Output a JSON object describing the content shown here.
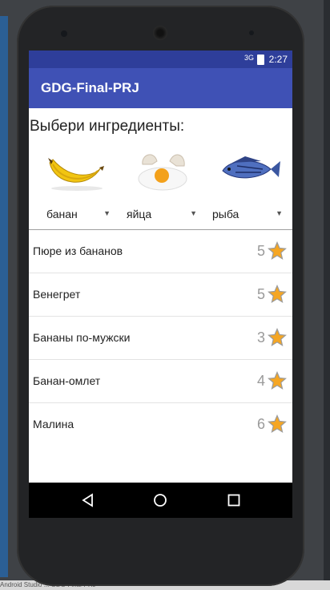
{
  "statusbar": {
    "signal": "3G",
    "time": "2:27"
  },
  "appbar": {
    "title": "GDG-Final-PRJ"
  },
  "main": {
    "prompt": "Выбери ингредиенты:",
    "ingredients": [
      {
        "icon": "banana-icon",
        "selected": "банан"
      },
      {
        "icon": "egg-icon",
        "selected": "яйца"
      },
      {
        "icon": "fish-icon",
        "selected": "рыба"
      }
    ],
    "recipes": [
      {
        "name": "Пюре из бананов",
        "rating": "5"
      },
      {
        "name": "Венегрет",
        "rating": "5"
      },
      {
        "name": "Бананы по-мужски",
        "rating": "3"
      },
      {
        "name": "Банан-омлет",
        "rating": "4"
      },
      {
        "name": "Малина",
        "rating": "6"
      }
    ]
  },
  "navbar": {
    "back": "back-icon",
    "home": "home-icon",
    "recents": "recents-icon"
  },
  "colors": {
    "primary": "#3f51b5",
    "primary_dark": "#2e3e9a",
    "star": "#f5a623"
  },
  "background": {
    "taskbar_text": "Android Studio ... GDG-Final-PRJ"
  }
}
